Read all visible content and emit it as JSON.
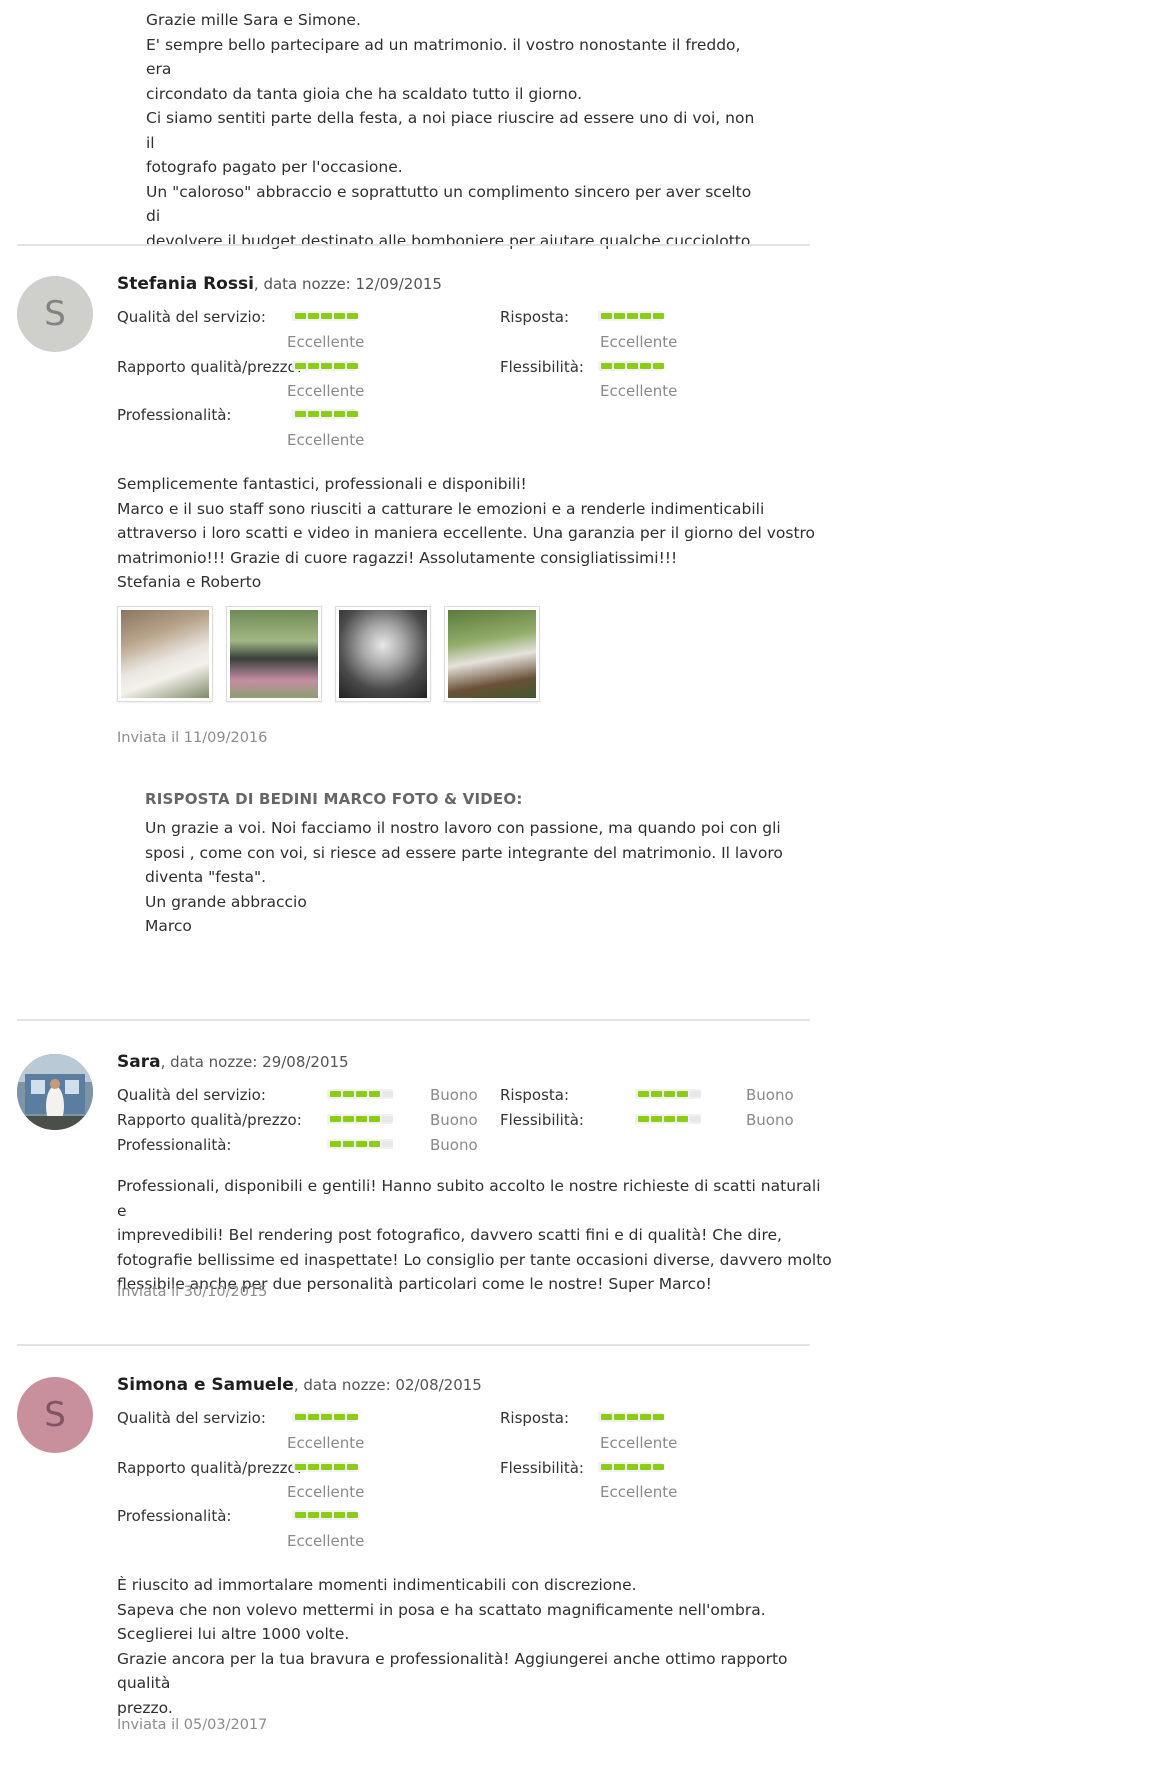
{
  "top_reply": {
    "lines": [
      "Grazie mille Sara e Simone.",
      "E' sempre bello partecipare ad un matrimonio. il vostro nonostante il freddo, era",
      "circondato da tanta gioia che ha scaldato tutto il giorno.",
      "Ci siamo sentiti parte della festa, a noi piace riuscire ad essere uno di voi, non il",
      "fotografo pagato per l'occasione.",
      "Un \"caloroso\" abbraccio e soprattutto un complimento sincero per aver scelto di",
      "devolvere il budget destinato alle bomboniere per aiutare qualche cucciolotto."
    ]
  },
  "labels": {
    "service": "Qualità del servizio:",
    "value": "Rapporto qualità/prezzo:",
    "professionalism": "Professionalità:",
    "response": "Risposta:",
    "flexibility": "Flessibilità:"
  },
  "reviews": [
    {
      "avatar_letter": "S",
      "name": "Stefania Rossi",
      "meta": ", data nozze: 12/09/2015",
      "ratings": {
        "service": {
          "stars": 5,
          "word": "Eccellente"
        },
        "value": {
          "stars": 5,
          "word": "Eccellente"
        },
        "professionalism": {
          "stars": 5,
          "word": "Eccellente"
        },
        "response": {
          "stars": 5,
          "word": "Eccellente"
        },
        "flexibility": {
          "stars": 5,
          "word": "Eccellente"
        }
      },
      "text": [
        "Semplicemente fantastici, professionali e disponibili!",
        "Marco e il suo staff sono riusciti a catturare le emozioni e a renderle indimenticabili",
        "attraverso i loro scatti e video in maniera eccellente. Una garanzia per il giorno del vostro",
        "matrimonio!!! Grazie di cuore ragazzi! Assolutamente consigliatissimi!!!",
        "Stefania e Roberto"
      ],
      "photos": [
        "bride-portrait",
        "couple-by-car",
        "church-doorway",
        "couple-in-garden"
      ],
      "sent": "Inviata il 11/09/2016",
      "reply": {
        "title": "RISPOSTA DI BEDINI MARCO FOTO & VIDEO:",
        "lines": [
          "Un grazie a voi. Noi facciamo il nostro lavoro con passione, ma quando poi con gli",
          "sposi , come con voi, si riesce ad essere parte integrante del matrimonio. Il lavoro",
          "diventa \"festa\".",
          "Un grande abbraccio",
          "Marco"
        ]
      }
    },
    {
      "avatar_letter": "",
      "name": "Sara",
      "meta": ", data nozze: 29/08/2015",
      "ratings": {
        "service": {
          "stars": 4,
          "word": "Buono"
        },
        "value": {
          "stars": 4,
          "word": "Buono"
        },
        "professionalism": {
          "stars": 4,
          "word": "Buono"
        },
        "response": {
          "stars": 4,
          "word": "Buono"
        },
        "flexibility": {
          "stars": 4,
          "word": "Buono"
        }
      },
      "text": [
        "Professionali, disponibili e gentili! Hanno subito accolto le nostre richieste di scatti naturali e",
        "imprevedibili! Bel rendering post fotografico, davvero scatti fini e di qualità! Che dire,",
        "fotografie bellissime ed inaspettate! Lo consiglio per tante occasioni diverse, davvero molto",
        "flessibile anche per due personalità particolari come le nostre! Super Marco!"
      ],
      "sent": "Inviata il 30/10/2015"
    },
    {
      "avatar_letter": "S",
      "name": "Simona e Samuele",
      "meta": ", data nozze: 02/08/2015",
      "ratings": {
        "service": {
          "stars": 5,
          "word": "Eccellente"
        },
        "value": {
          "stars": 5,
          "word": "Eccellente"
        },
        "professionalism": {
          "stars": 5,
          "word": "Eccellente"
        },
        "response": {
          "stars": 5,
          "word": "Eccellente"
        },
        "flexibility": {
          "stars": 5,
          "word": "Eccellente"
        }
      },
      "text": [
        "È riuscito ad immortalare momenti indimenticabili con discrezione.",
        "Sapeva che non volevo mettermi in posa e ha scattato magnificamente nell'ombra.",
        "Sceglierei lui altre 1000 volte.",
        "Grazie ancora per la tua bravura e professionalità! Aggiungerei anche ottimo rapporto qualità",
        "prezzo."
      ],
      "sent": "Inviata il 05/03/2017"
    }
  ],
  "colors": {
    "rating_on": "#8bcc14",
    "rating_off": "#e8e8e8",
    "divider": "#e3e3e3"
  }
}
